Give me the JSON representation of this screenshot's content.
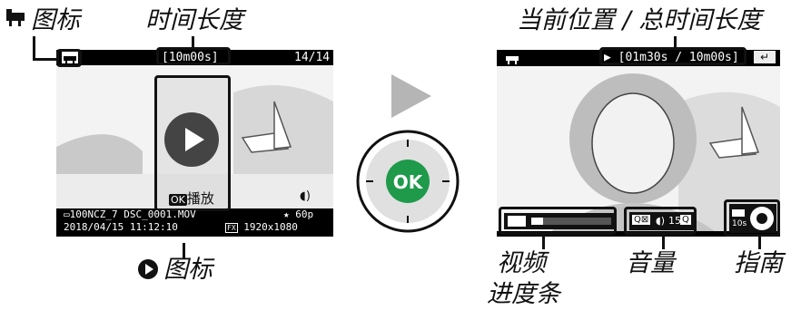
{
  "left": {
    "icon_caption_glyph": "▝▜",
    "icon_caption": "图标",
    "length_caption": "时间长度",
    "play_caption": "图标",
    "length_readout": "[10m00s]",
    "frame_counter": "14/14",
    "ok_badge": "OK",
    "play_label": "播放",
    "folder_line": "▭100NCZ_7 DSC_0001.MOV",
    "datetime": "2018/04/15 11:12:10",
    "frame_rate": "★ 60p",
    "size_badge": "FX",
    "resolution": "1920x1080",
    "speaker_glyph": "◖)"
  },
  "center": {
    "ok_button_label": "OK",
    "arrow_color": "#b5b5b5",
    "ok_color": "#1e9a4a"
  },
  "right": {
    "position_caption": "当前位置 / 总时间长度",
    "position_readout": "▶ [01m30s / 10m00s]",
    "back_glyph": "↵",
    "progress_caption_1": "视频",
    "progress_caption_2": "进度条",
    "volume_caption": "音量",
    "guide_caption": "指南",
    "volume_value": "15",
    "zoom_out_glyph": "Q⊠",
    "zoom_in_glyph": "Q",
    "guide_time": "10s",
    "progress_fraction": 0.15
  }
}
